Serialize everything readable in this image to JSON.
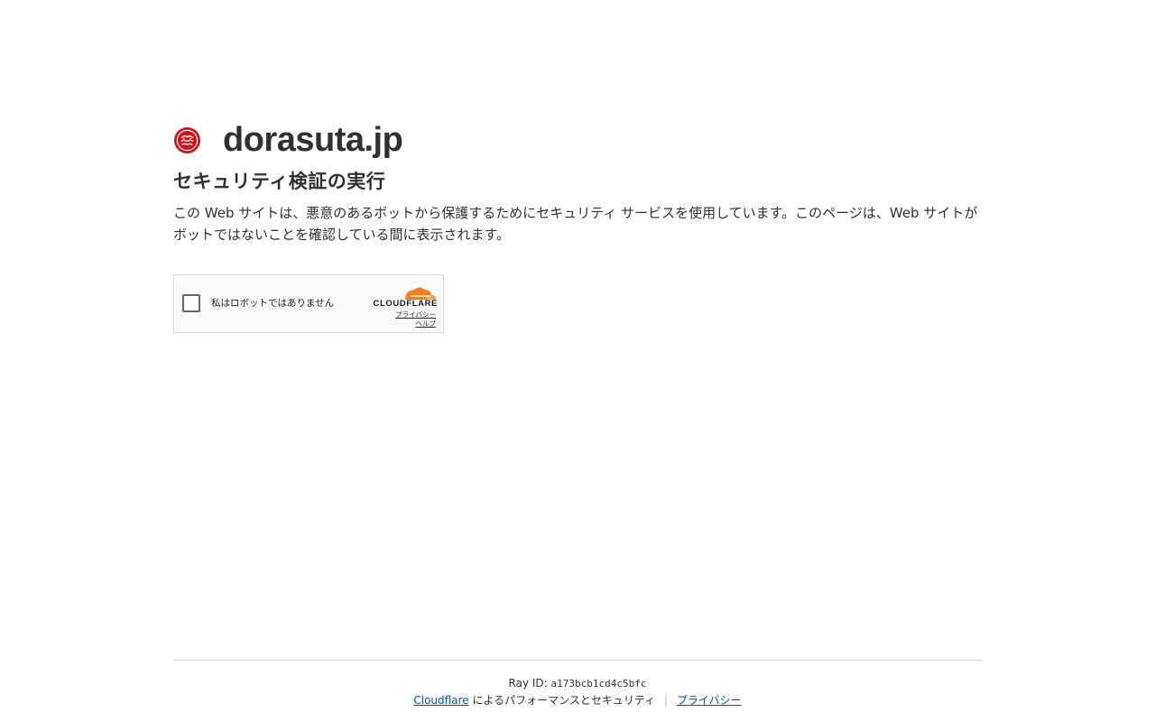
{
  "site": {
    "name": "dorasuta.jp",
    "logo_icon": "dorasuta-logo-icon"
  },
  "headline": "セキュリティ検証の実行",
  "description": "この Web サイトは、悪意のあるボットから保護するためにセキュリティ サービスを使用しています。このページは、Web サイトがボットではないことを確認している間に表示されます。",
  "widget": {
    "checkbox_label": "私はロボットではありません",
    "checked": false,
    "brand": "CLOUDFLARE",
    "privacy_link": "プライバシー",
    "help_link": "ヘルプ"
  },
  "footer": {
    "ray_label": "Ray ID:",
    "ray_id": "a173bcb1cd4c5bfc",
    "cloudflare_link": "Cloudflare",
    "performance_text": "によるパフォーマンスとセキュリティ",
    "separator": "|",
    "privacy_link": "プライバシー"
  },
  "colors": {
    "brand_red": "#d0141c",
    "cloudflare_orange": "#f38020",
    "cloudflare_light_orange": "#fbad41",
    "link_blue": "#0051c3",
    "text": "#313131"
  }
}
